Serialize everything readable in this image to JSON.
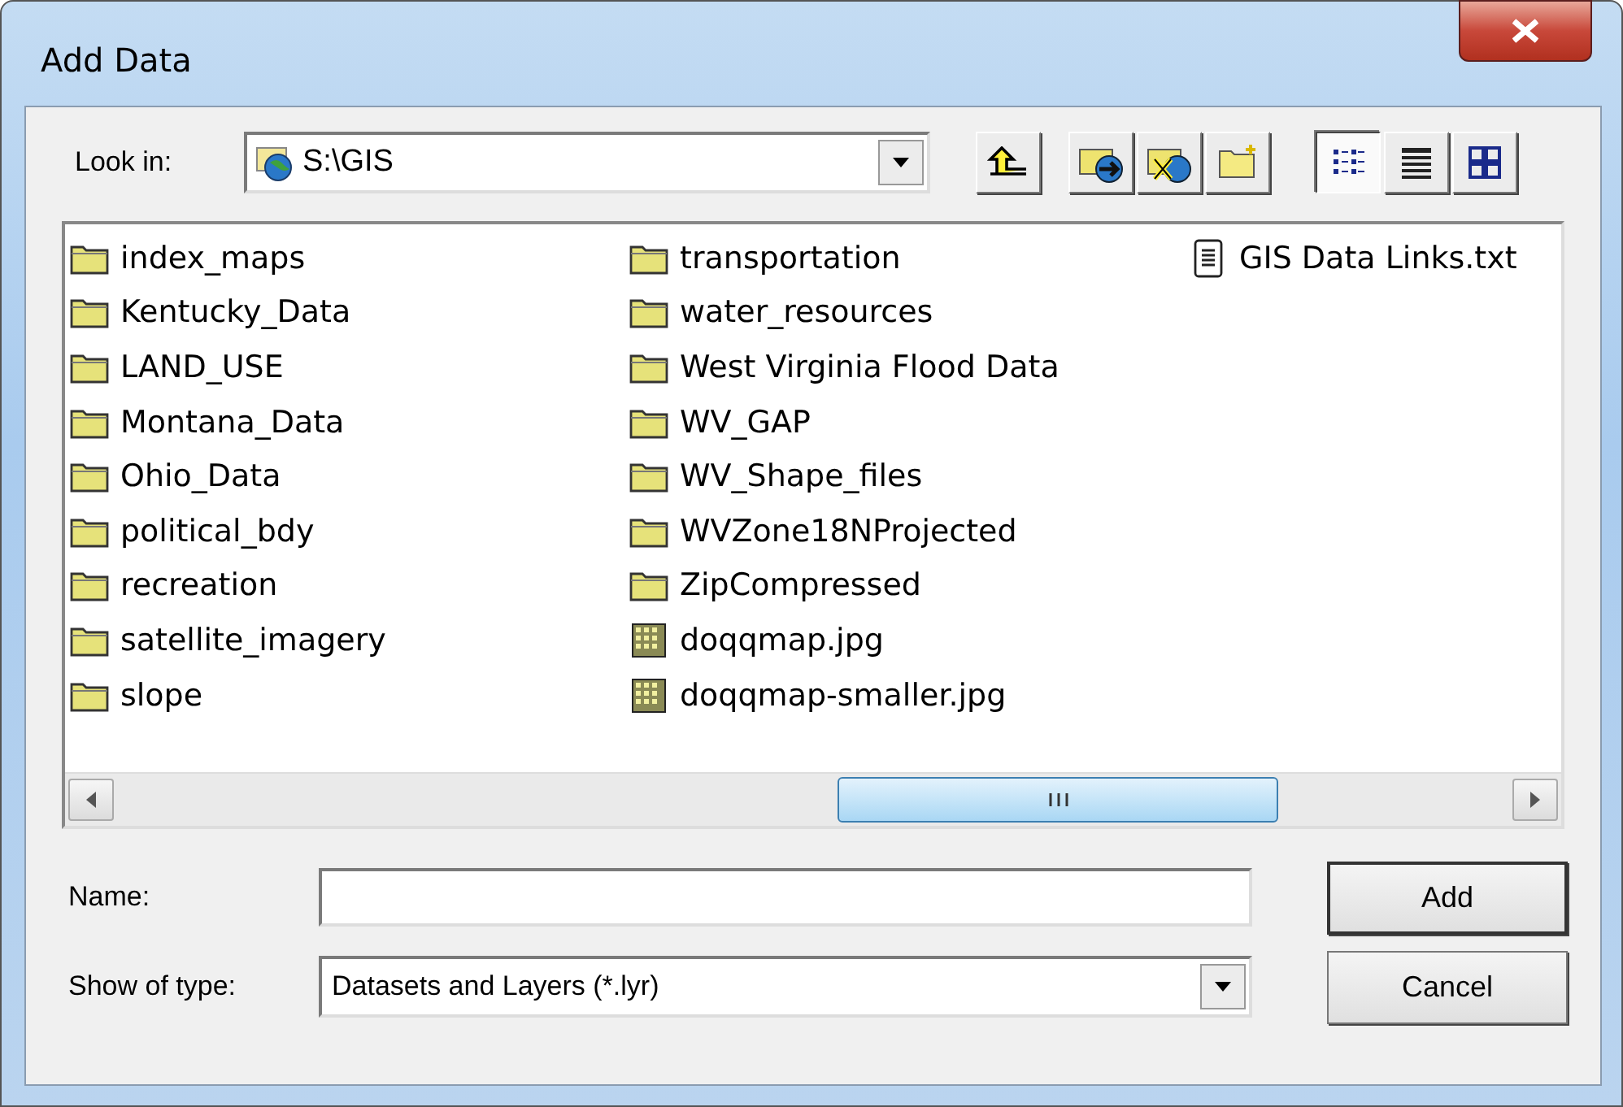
{
  "window": {
    "title": "Add Data"
  },
  "look_in": {
    "label": "Look in:",
    "value": "S:\\GIS"
  },
  "view_modes": [
    {
      "kind": "list",
      "selected": true
    },
    {
      "kind": "details",
      "selected": false
    },
    {
      "kind": "thumbnails",
      "selected": false
    }
  ],
  "files": [
    {
      "name": "index_maps",
      "kind": "folder"
    },
    {
      "name": "Kentucky_Data",
      "kind": "folder"
    },
    {
      "name": "LAND_USE",
      "kind": "folder"
    },
    {
      "name": "Montana_Data",
      "kind": "folder"
    },
    {
      "name": "Ohio_Data",
      "kind": "folder"
    },
    {
      "name": "political_bdy",
      "kind": "folder"
    },
    {
      "name": "recreation",
      "kind": "folder"
    },
    {
      "name": "satellite_imagery",
      "kind": "folder"
    },
    {
      "name": "slope",
      "kind": "folder"
    },
    {
      "name": "transportation",
      "kind": "folder"
    },
    {
      "name": "water_resources",
      "kind": "folder"
    },
    {
      "name": "West Virginia Flood Data",
      "kind": "folder"
    },
    {
      "name": "WV_GAP",
      "kind": "folder"
    },
    {
      "name": "WV_Shape_files",
      "kind": "folder"
    },
    {
      "name": "WVZone18NProjected",
      "kind": "folder"
    },
    {
      "name": "ZipCompressed",
      "kind": "folder"
    },
    {
      "name": "doqqmap.jpg",
      "kind": "image"
    },
    {
      "name": "doqqmap-smaller.jpg",
      "kind": "image"
    },
    {
      "name": "GIS Data Links.txt",
      "kind": "text"
    }
  ],
  "name_field": {
    "label": "Name:"
  },
  "type_field": {
    "label": "Show of type:",
    "value": "Datasets and Layers (*.lyr)"
  },
  "buttons": [
    "Add",
    "Cancel"
  ]
}
